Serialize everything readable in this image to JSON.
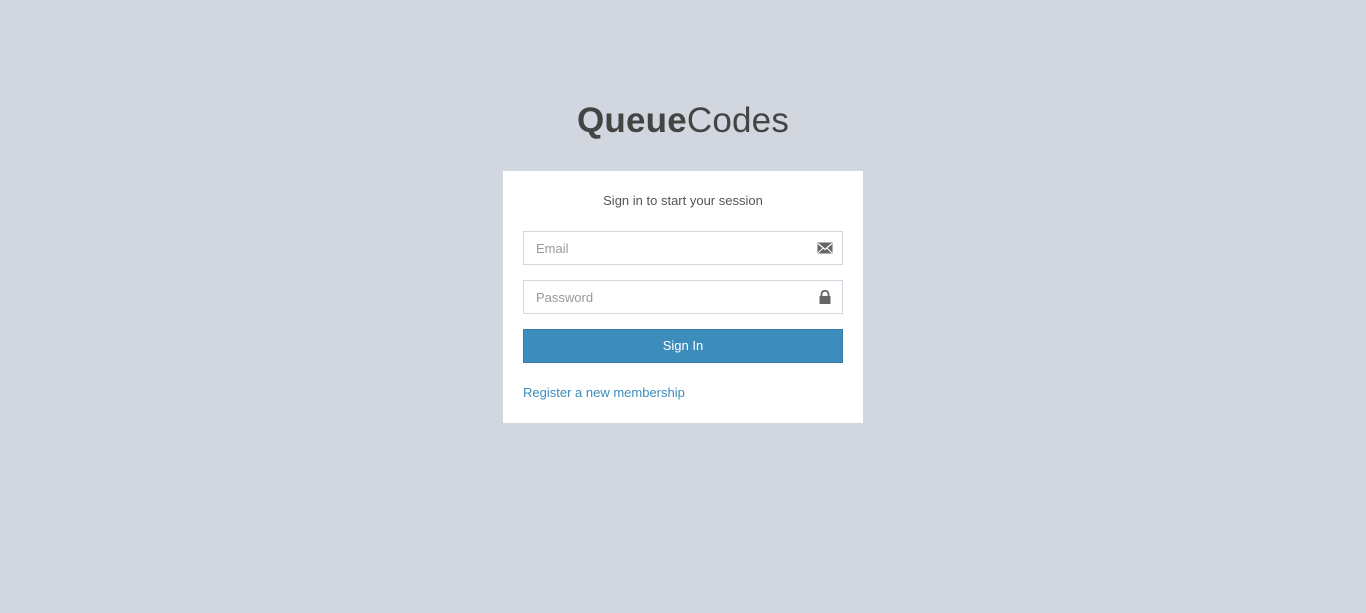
{
  "logo": {
    "bold": "Queue",
    "light": "Codes"
  },
  "login": {
    "message": "Sign in to start your session",
    "email": {
      "placeholder": "Email",
      "value": "",
      "icon": "envelope-icon"
    },
    "password": {
      "placeholder": "Password",
      "value": "",
      "icon": "lock-icon"
    },
    "signin_label": "Sign In",
    "register_label": "Register a new membership"
  },
  "colors": {
    "page_background": "#d2d6de",
    "box_background": "#ffffff",
    "accent": "#3c8dbc",
    "icon": "#666666",
    "text": "#444444"
  }
}
